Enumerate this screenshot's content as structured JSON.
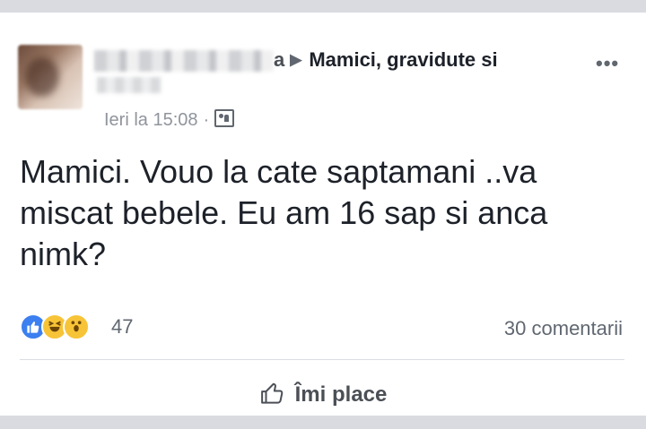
{
  "post": {
    "author_fragment": "a",
    "group_name": "Mamici, gravidute si",
    "timestamp": "Ieri la 15:08",
    "separator": "·",
    "audience_icon": "group-audience-icon",
    "more_label": "•••",
    "text": "Mamici. Vouo la cate saptamani ..va miscat bebele. Eu am 16 sap si anca nimk?"
  },
  "reactions": {
    "icons": [
      "like-icon",
      "haha-icon",
      "wow-icon"
    ],
    "count": "47",
    "comments": "30 comentarii"
  },
  "actions": {
    "like_label": "Îmi place",
    "like_icon": "thumbs-up-icon"
  },
  "colors": {
    "background": "#d9dbe0",
    "text": "#1d2129",
    "secondary": "#606770",
    "like_blue": "#3b7ff0",
    "emoji_yellow": "#f7c438"
  }
}
